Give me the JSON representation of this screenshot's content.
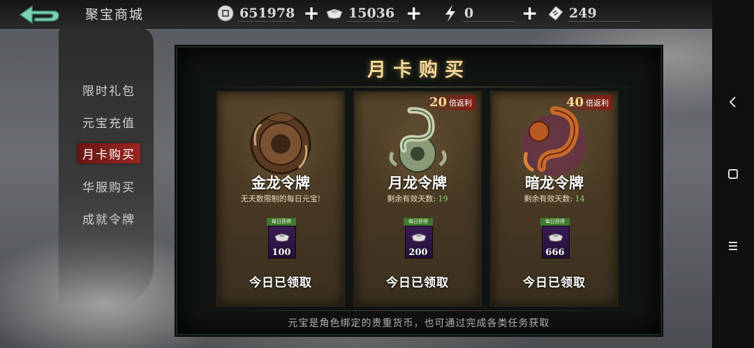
{
  "top_bar": {
    "shop_title": "聚宝商城",
    "resources": [
      {
        "icon": "coin-icon",
        "value": "651978"
      },
      {
        "icon": "ingot-icon",
        "value": "15036"
      },
      {
        "icon": "lightning-icon",
        "value": "0"
      },
      {
        "icon": "ticket-icon",
        "value": "249"
      }
    ],
    "plus_label": "+"
  },
  "sidebar": {
    "items": [
      {
        "label": "限时礼包",
        "active": false
      },
      {
        "label": "元宝充值",
        "active": false
      },
      {
        "label": "月卡购买",
        "active": true
      },
      {
        "label": "华服购买",
        "active": false
      },
      {
        "label": "成就令牌",
        "active": false
      }
    ]
  },
  "main": {
    "title": "月卡购买",
    "footer_note": "元宝是角色绑定的贵重货币，也可通过完成各类任务获取",
    "cards": [
      {
        "name": "金龙令牌",
        "subtitle": "无天数限制的每日元宝!",
        "badge_number": "",
        "badge_text": "",
        "daily_label": "每日获得",
        "daily_value": "100",
        "status": "今日已领取"
      },
      {
        "name": "月龙令牌",
        "subtitle_prefix": "剩余有效天数:",
        "subtitle_days": "19",
        "badge_number": "20",
        "badge_text": "倍返利",
        "daily_label": "每日获得",
        "daily_value": "200",
        "status": "今日已领取"
      },
      {
        "name": "暗龙令牌",
        "subtitle_prefix": "剩余有效天数:",
        "subtitle_days": "14",
        "badge_number": "40",
        "badge_text": "倍返利",
        "daily_label": "每日获得",
        "daily_value": "666",
        "status": "今日已领取"
      }
    ]
  },
  "system_nav": {
    "back_icon": "chevron-left-icon",
    "home_icon": "square-icon",
    "menu_icon": "menu-icon"
  },
  "colors": {
    "title_gold": "#f1d79a",
    "active_tab": "#9a2522",
    "days_green": "#8fd46d",
    "daily_purple": "#3a1b53"
  }
}
